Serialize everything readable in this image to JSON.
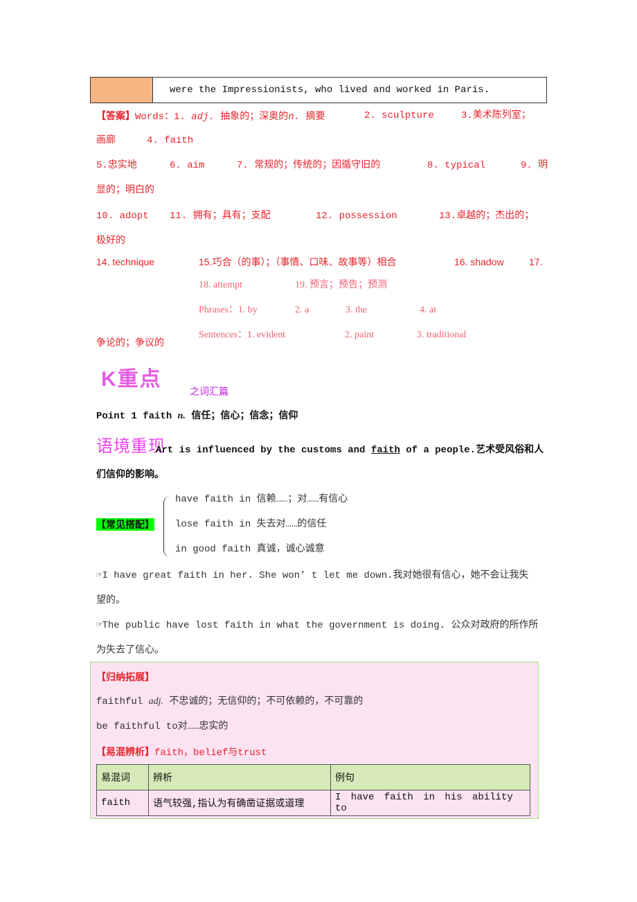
{
  "top_row": {
    "text": "were the Impressionists, who lived and worked in Paris."
  },
  "answers": {
    "line1": {
      "label": "【答案】",
      "words": "Words：1. ",
      "adj": "adj.",
      "a1": " 抽象的；深奥的",
      "n": "n.",
      "a1b": " 摘要",
      "a2": "2. sculpture",
      "a3": "3.美术陈列室；"
    },
    "line2": {
      "a3b": "画廊",
      "a4": "4. faith"
    },
    "line3": {
      "a5": "5.忠实地",
      "a6": "6. aim",
      "a7": "7. 常规的；传统的；因循守旧的",
      "a8": "8. typical",
      "a9": "9. 明"
    },
    "line4": {
      "a9b": "显的；明白的"
    },
    "line5": {
      "a10": "10. adopt",
      "a11": "11. 拥有；具有；支配",
      "a12": "12. possession",
      "a13": "13.卓越的；杰出的；"
    },
    "line6": {
      "a13b": "极好的"
    },
    "line7": {
      "a14": "14. technique",
      "a15": "15.巧合（的事）；（事情、口味、故事等）相合",
      "a16": "16. shadow",
      "a17": "17."
    },
    "line8": {
      "a18": "18. attempt",
      "a19": "19. 预言；预告；预测"
    },
    "phrases": {
      "label": "Phrases：1. by",
      "p2": "2. a",
      "p3": "3. the",
      "p4": "4. at"
    },
    "sentences": {
      "label": "Sentences：1. evident",
      "s2": "2. paint",
      "s3": "3. traditional"
    },
    "a17b": "争论的；争议的"
  },
  "section": {
    "logo": "K重点",
    "title": "之词汇篇"
  },
  "point": {
    "head": "Point 1  faith ",
    "n": "n.",
    "meaning": " 信任；信心；信念；信仰"
  },
  "context": {
    "logo": "语境重现",
    "pre": "Art is influenced by the customs and ",
    "word": "faith",
    "post": " of a people.艺术受风俗和人",
    "line2": "们信仰的影响。"
  },
  "collocations": {
    "label": "【常见搭配】",
    "items": [
      "have faith in 信赖……；对……有信心",
      "lose faith in 失去对……的信任",
      "in good faith 真诚，诚心诚意"
    ]
  },
  "examples": [
    {
      "icon": "pointing-hand",
      "line1": "I have great faith in her. She won’ t let me down.我对她很有信心，她不会让我失",
      "line2": "望的。"
    },
    {
      "icon": "pointing-hand",
      "line1": "The public have lost faith in what the government is doing. 公众对政府的所作所",
      "line2": "为失去了信心。"
    }
  ],
  "summary": {
    "label": "【归纳拓展】",
    "line1_pre": "faithful ",
    "adj": "adj.",
    "line1_post": " 不忠诚的；无信仰的；不可依赖的，不可靠的",
    "line2": "be faithful to对……忠实的",
    "confuse_label": "【易混辨析】",
    "confuse_text": "faith，belief与trust",
    "table": {
      "headers": [
        "易混词",
        "辨析",
        "例句"
      ],
      "rows": [
        [
          "faith",
          "语气较强,指认为有确凿证据或道理",
          "I have faith in his ability to"
        ]
      ]
    }
  },
  "colors": {
    "answer_red": "#e8232b",
    "highlight_green": "#00ff00",
    "box_pink": "#fbe3f1",
    "table_head": "#d6e9b8",
    "logo_magenta": "#e040e0"
  }
}
